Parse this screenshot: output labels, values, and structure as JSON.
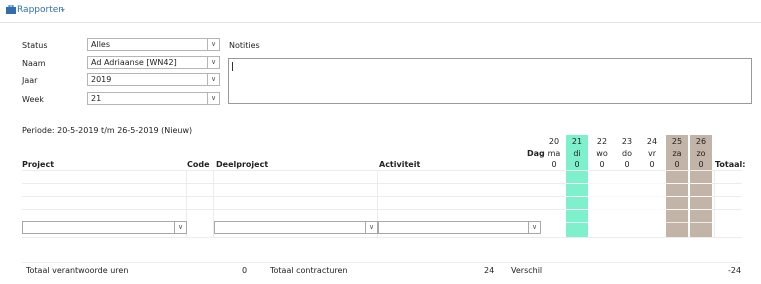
{
  "header": {
    "title": "Rapporten",
    "icon": "briefcase-icon"
  },
  "filters": {
    "status": {
      "label": "Status",
      "value": "Alles"
    },
    "naam": {
      "label": "Naam",
      "value": "Ad Adriaanse [WN42]"
    },
    "jaar": {
      "label": "Jaar",
      "value": "2019"
    },
    "week": {
      "label": "Week",
      "value": "21"
    },
    "notities_label": "Notities"
  },
  "periode": "Periode: 20-5-2019 t/m 26-5-2019 (Nieuw)",
  "columns": {
    "project": "Project",
    "code": "Code",
    "deelproject": "Deelproject",
    "activiteit": "Activiteit",
    "dag": "Dag",
    "totaal": "Totaal:"
  },
  "days": [
    {
      "num": "20",
      "name": "ma",
      "hours": "0",
      "style": "normal"
    },
    {
      "num": "21",
      "name": "di",
      "hours": "0",
      "style": "today"
    },
    {
      "num": "22",
      "name": "wo",
      "hours": "0",
      "style": "normal"
    },
    {
      "num": "23",
      "name": "do",
      "hours": "0",
      "style": "normal"
    },
    {
      "num": "24",
      "name": "vr",
      "hours": "0",
      "style": "normal"
    },
    {
      "num": "25",
      "name": "za",
      "hours": "0",
      "style": "weekend"
    },
    {
      "num": "26",
      "name": "zo",
      "hours": "0",
      "style": "weekend"
    }
  ],
  "totals": {
    "verantwoord_label": "Totaal verantwoorde uren",
    "verantwoord_value": "0",
    "contract_label": "Totaal contracturen",
    "contract_value": "24",
    "verschil_label": "Verschil",
    "verschil_value": "-24"
  },
  "colors": {
    "accent": "#2f6fb0",
    "today": "#7ff0cc",
    "weekend": "#c2b4a6"
  }
}
